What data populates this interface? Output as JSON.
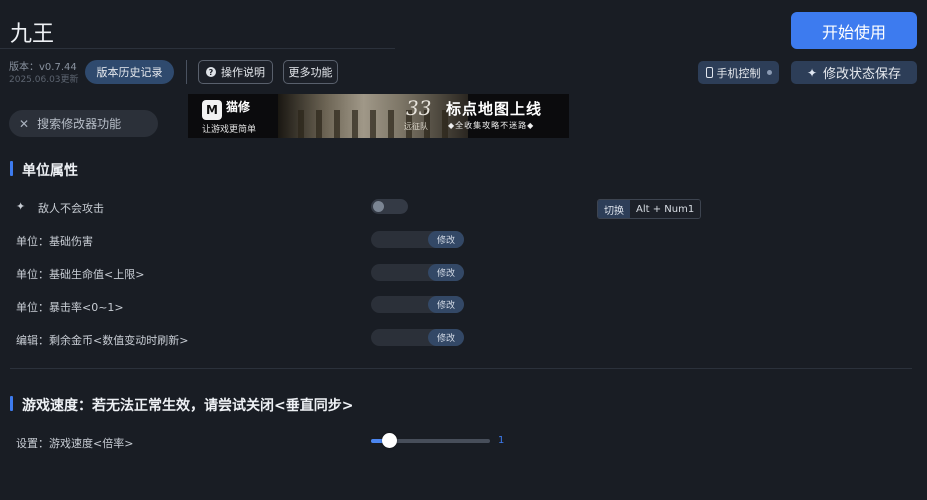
{
  "app": {
    "title": "九王",
    "version": "版本：v0.7.44",
    "version_date": "2025.06.03更新"
  },
  "toolbar": {
    "history_label": "版本历史记录",
    "help_label": "操作说明",
    "more_label": "更多功能",
    "start_label": "开始使用",
    "phone_label": "手机控制",
    "save_state_label": "修改状态保存"
  },
  "search": {
    "placeholder": "搜索修改器功能"
  },
  "banner": {
    "brand": "猫修",
    "tagline_left": "让游戏更简单",
    "number": "33",
    "number_sub": "远征队",
    "headline": "标点地图上线",
    "tagline_right": "◆全收集攻略不迷路◆"
  },
  "sections": {
    "unit": {
      "title": "单位属性",
      "rows": [
        {
          "label": "敌人不会攻击",
          "type": "toggle",
          "on": false
        },
        {
          "label": "单位：基础伤害",
          "type": "edit",
          "button": "修改"
        },
        {
          "label": "单位：基础生命值<上限>",
          "type": "edit",
          "button": "修改"
        },
        {
          "label": "单位：暴击率<0~1>",
          "type": "edit",
          "button": "修改"
        },
        {
          "label": "编辑：剩余金币<数值变动时刷新>",
          "type": "edit",
          "button": "修改"
        }
      ],
      "hotkey": {
        "action": "切换",
        "keys": "Alt + Num1"
      }
    },
    "speed": {
      "title": "游戏速度：若无法正常生效，请尝试关闭<垂直同步>",
      "slider_label": "设置：游戏速度<倍率>",
      "slider_value": "1"
    }
  },
  "colors": {
    "accent": "#3d7bef",
    "background": "#191d24"
  }
}
